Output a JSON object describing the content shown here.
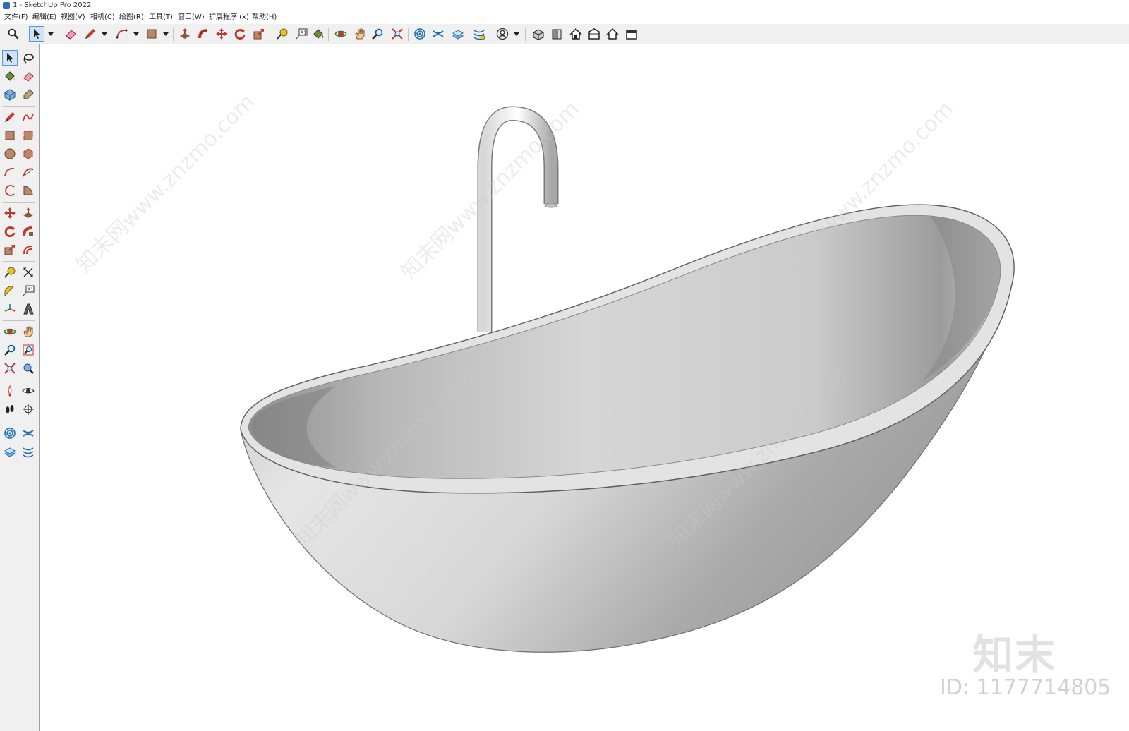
{
  "window": {
    "title": "1 - SketchUp Pro 2022"
  },
  "menu": {
    "items": [
      "文件(F)",
      "编辑(E)",
      "视图(V)",
      "相机(C)",
      "绘图(R)",
      "工具(T)",
      "窗口(W)",
      "扩展程序 (x)",
      "帮助(H)"
    ]
  },
  "toolbar": {
    "tools": [
      "zoom-icon",
      "select-icon",
      "eraser-icon",
      "pencil-icon",
      "arc-icon",
      "rectangle-icon",
      "push-pull-icon",
      "follow-me-icon",
      "move-icon",
      "rotate-icon",
      "scale-icon",
      "tape-measure-icon",
      "text-icon",
      "paint-bucket-icon",
      "orbit-icon",
      "pan-icon",
      "zoom-tool-icon",
      "zoom-extents-icon",
      "sandbox-smoove-icon",
      "sandbox-stamp-icon",
      "sandbox-drape-icon",
      "sandbox-detail-icon",
      "account-icon",
      "iso-view-icon",
      "front-view-icon",
      "top-view-icon",
      "right-view-icon",
      "back-view-icon",
      "left-view-icon"
    ]
  },
  "viewport": {
    "watermark_logo": "知末",
    "watermark_id": "ID: 1177714805",
    "watermark_repeat": "知末网www.znzmo.com"
  },
  "colors": {
    "chrome": "#f0f0f0",
    "active_tool": "#cfe3fb",
    "tub_light": "#e6e6e6",
    "tub_shadow": "#9a9a9a"
  }
}
